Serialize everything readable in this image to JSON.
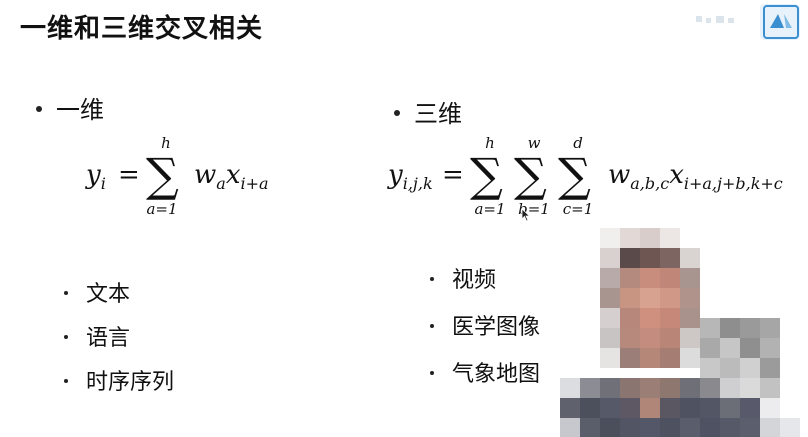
{
  "title": "一维和三维交叉相关",
  "left_section": {
    "heading": "一维",
    "formula": {
      "lhs_var": "y",
      "lhs_sub": "i",
      "equals": "=",
      "upper": "h",
      "lower": "a=1",
      "w": "w",
      "w_sub": "a",
      "x": "x",
      "x_sub": "i+a"
    },
    "items": [
      "文本",
      "语言",
      "时序序列"
    ]
  },
  "right_section": {
    "heading": "三维",
    "formula": {
      "lhs_var": "y",
      "lhs_sub": "i,j,k",
      "equals": "=",
      "sum1_upper": "h",
      "sum1_lower": "a=1",
      "sum2_upper": "w",
      "sum2_lower": "b=1",
      "sum3_upper": "d",
      "sum3_lower": "c=1",
      "w": "w",
      "w_sub": "a,b,c",
      "x": "x",
      "x_sub": "i+a,j+b,k+c"
    },
    "items": [
      "视频",
      "医学图像",
      "气象地图"
    ]
  },
  "icons": {
    "watermark": "bilibili-logo-icon",
    "cursor": "mouse-pointer-icon",
    "overlay": "pixelated-webcam-presenter"
  }
}
